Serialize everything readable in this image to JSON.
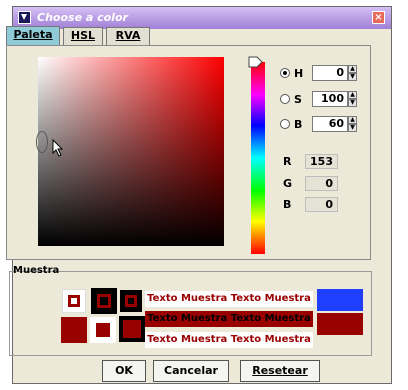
{
  "window": {
    "title": "Choose a color",
    "close_symbol": "×"
  },
  "tabs": [
    {
      "label": "Paleta",
      "active": true
    },
    {
      "label": "HSL",
      "active": false
    },
    {
      "label": "RVA",
      "active": false
    }
  ],
  "hsb": {
    "h": {
      "label": "H",
      "value": "0",
      "selected": true
    },
    "s": {
      "label": "S",
      "value": "100",
      "selected": false
    },
    "b": {
      "label": "B",
      "value": "60",
      "selected": false
    }
  },
  "rgb": {
    "r": {
      "label": "R",
      "value": "153"
    },
    "g": {
      "label": "G",
      "value": "0"
    },
    "b": {
      "label": "B",
      "value": "0"
    }
  },
  "muestra": {
    "title": "Muestra",
    "sample_text": "Texto Muestra Texto Muestra"
  },
  "colors": {
    "selected": "#990000",
    "previous": "#1f3fff",
    "tab_active": "#8fcbd6"
  },
  "buttons": {
    "ok": "OK",
    "cancel": "Cancelar",
    "reset": "Resetear"
  }
}
